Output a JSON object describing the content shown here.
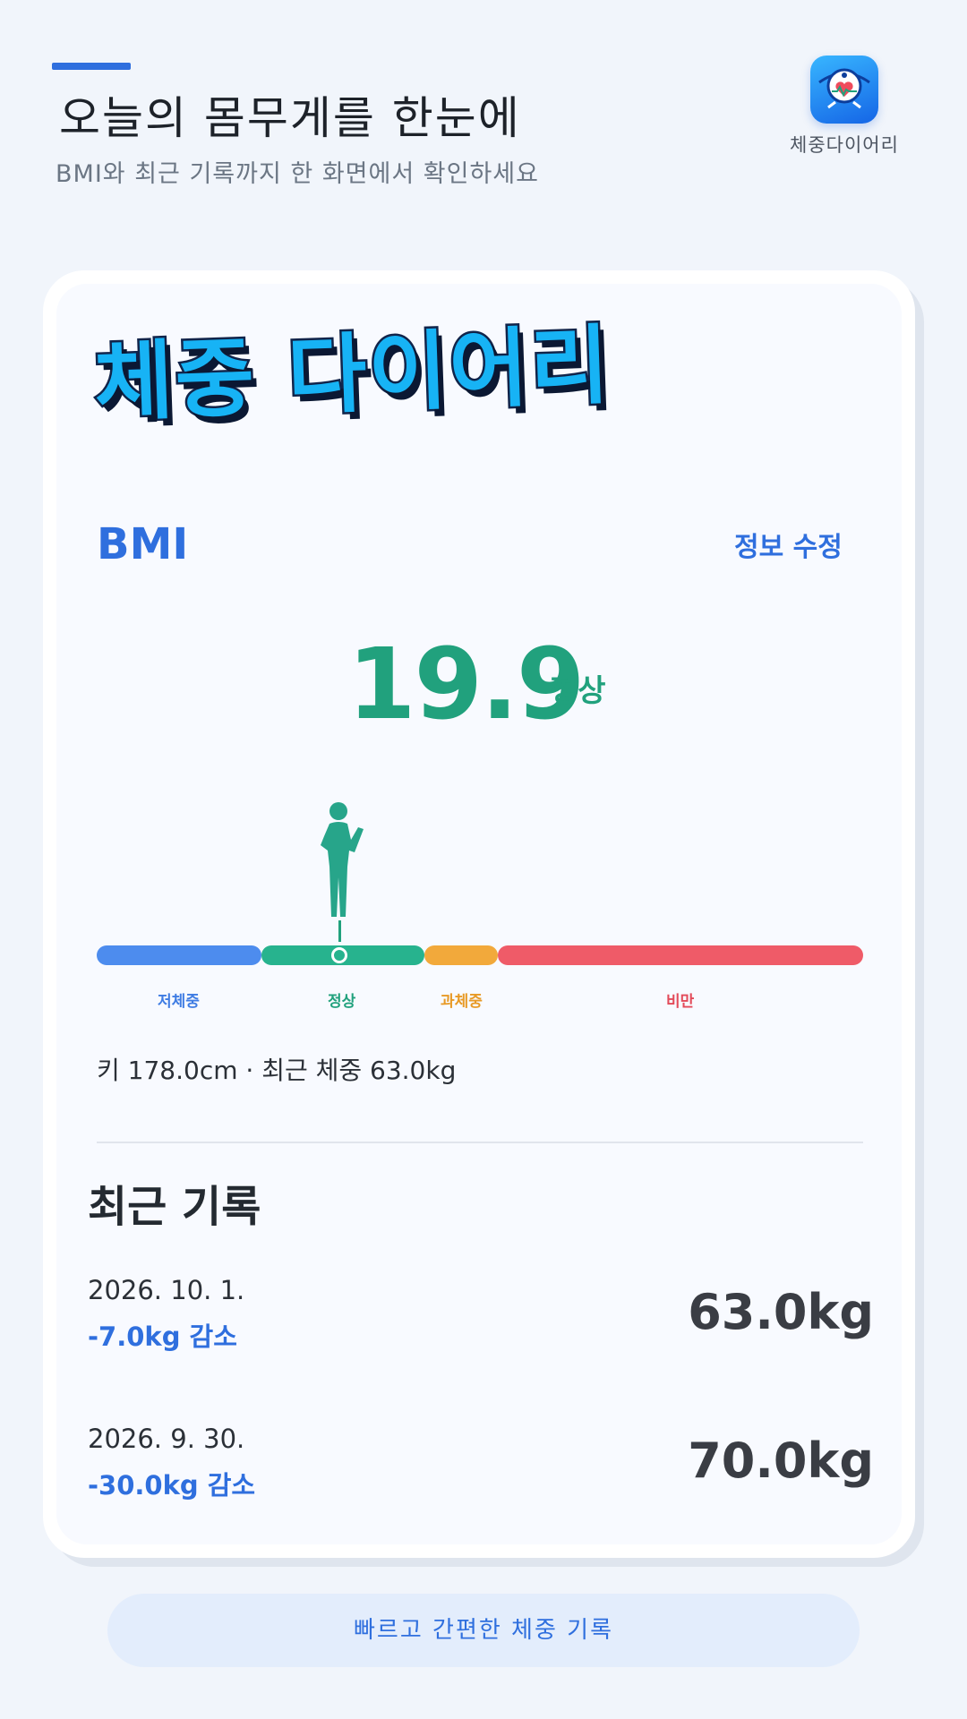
{
  "header": {
    "title": "오늘의 몸무게를 한눈에",
    "subtitle": "BMI와 최근 기록까지 한 화면에서 확인하세요",
    "app_name": "체중다이어리",
    "app_icon": "scale-heart-icon"
  },
  "card": {
    "logo_title": "체중 다이어리",
    "bmi_label": "BMI",
    "edit_label": "정보 수정",
    "bmi_value": "19.9",
    "bmi_status": "정상",
    "scale": {
      "labels": [
        "저체중",
        "정상",
        "과체중",
        "비만"
      ],
      "colors": [
        "#4d8cee",
        "#27b38e",
        "#f2a93b",
        "#ef5b68"
      ]
    },
    "stats_line": "키 178.0cm · 최근 체중 63.0kg",
    "recent_heading": "최근 기록",
    "records": [
      {
        "date": "2026. 10. 1.",
        "change": "-7.0kg 감소",
        "weight": "63.0kg"
      },
      {
        "date": "2026. 9. 30.",
        "change": "-30.0kg 감소",
        "weight": "70.0kg"
      }
    ]
  },
  "footer": {
    "tagline": "빠르고 간편한 체중 기록"
  }
}
